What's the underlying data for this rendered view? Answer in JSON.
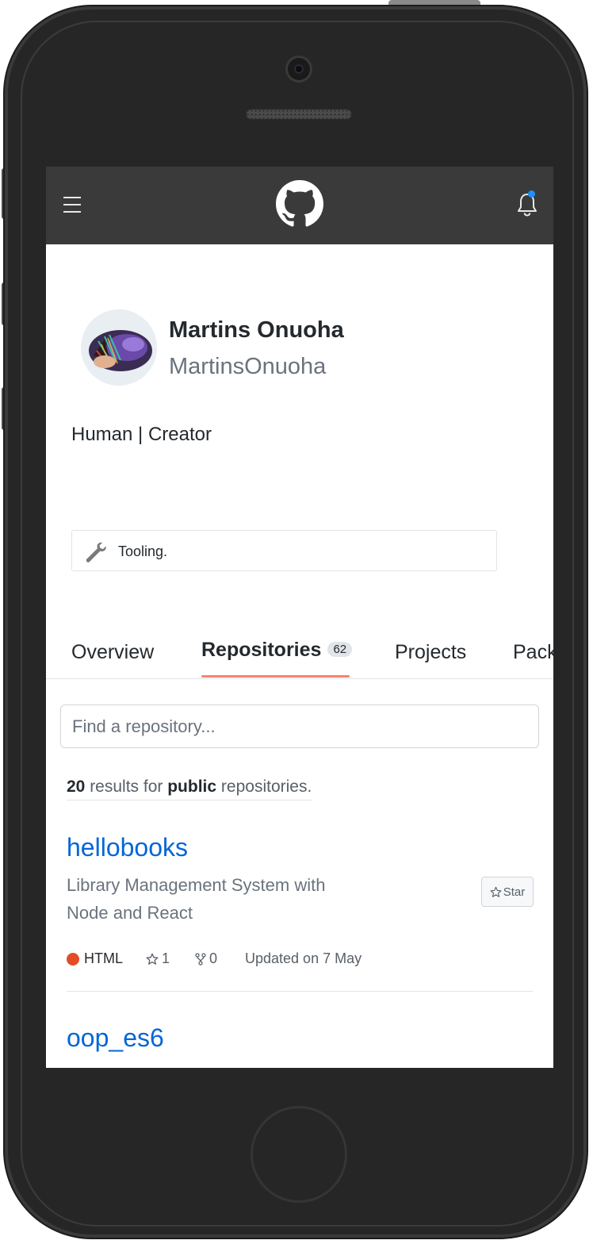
{
  "header": {
    "menu_icon": "hamburger-icon",
    "logo_icon": "github-logo-icon",
    "notification_icon": "bell-icon",
    "notification_dot_color": "#1e90ff"
  },
  "profile": {
    "name": "Martins Onuoha",
    "login": "MartinsOnuoha",
    "bio": "Human | Creator",
    "status": "Tooling."
  },
  "tabs": [
    {
      "label": "Overview"
    },
    {
      "label": "Repositories",
      "counter": "62",
      "selected": true
    },
    {
      "label": "Projects"
    },
    {
      "label": "Pack"
    }
  ],
  "search": {
    "placeholder": "Find a repository..."
  },
  "results": {
    "count": "20",
    "text_mid": " results for ",
    "type": "public",
    "text_end": " repositories."
  },
  "repos": [
    {
      "name": "hellobooks",
      "description": "Library Management System with Node and React",
      "star_button": "Star",
      "language": "HTML",
      "language_color": "#e34c26",
      "stars": "1",
      "forks": "0",
      "updated": "Updated on 7 May"
    },
    {
      "name": "oop_es6"
    }
  ]
}
